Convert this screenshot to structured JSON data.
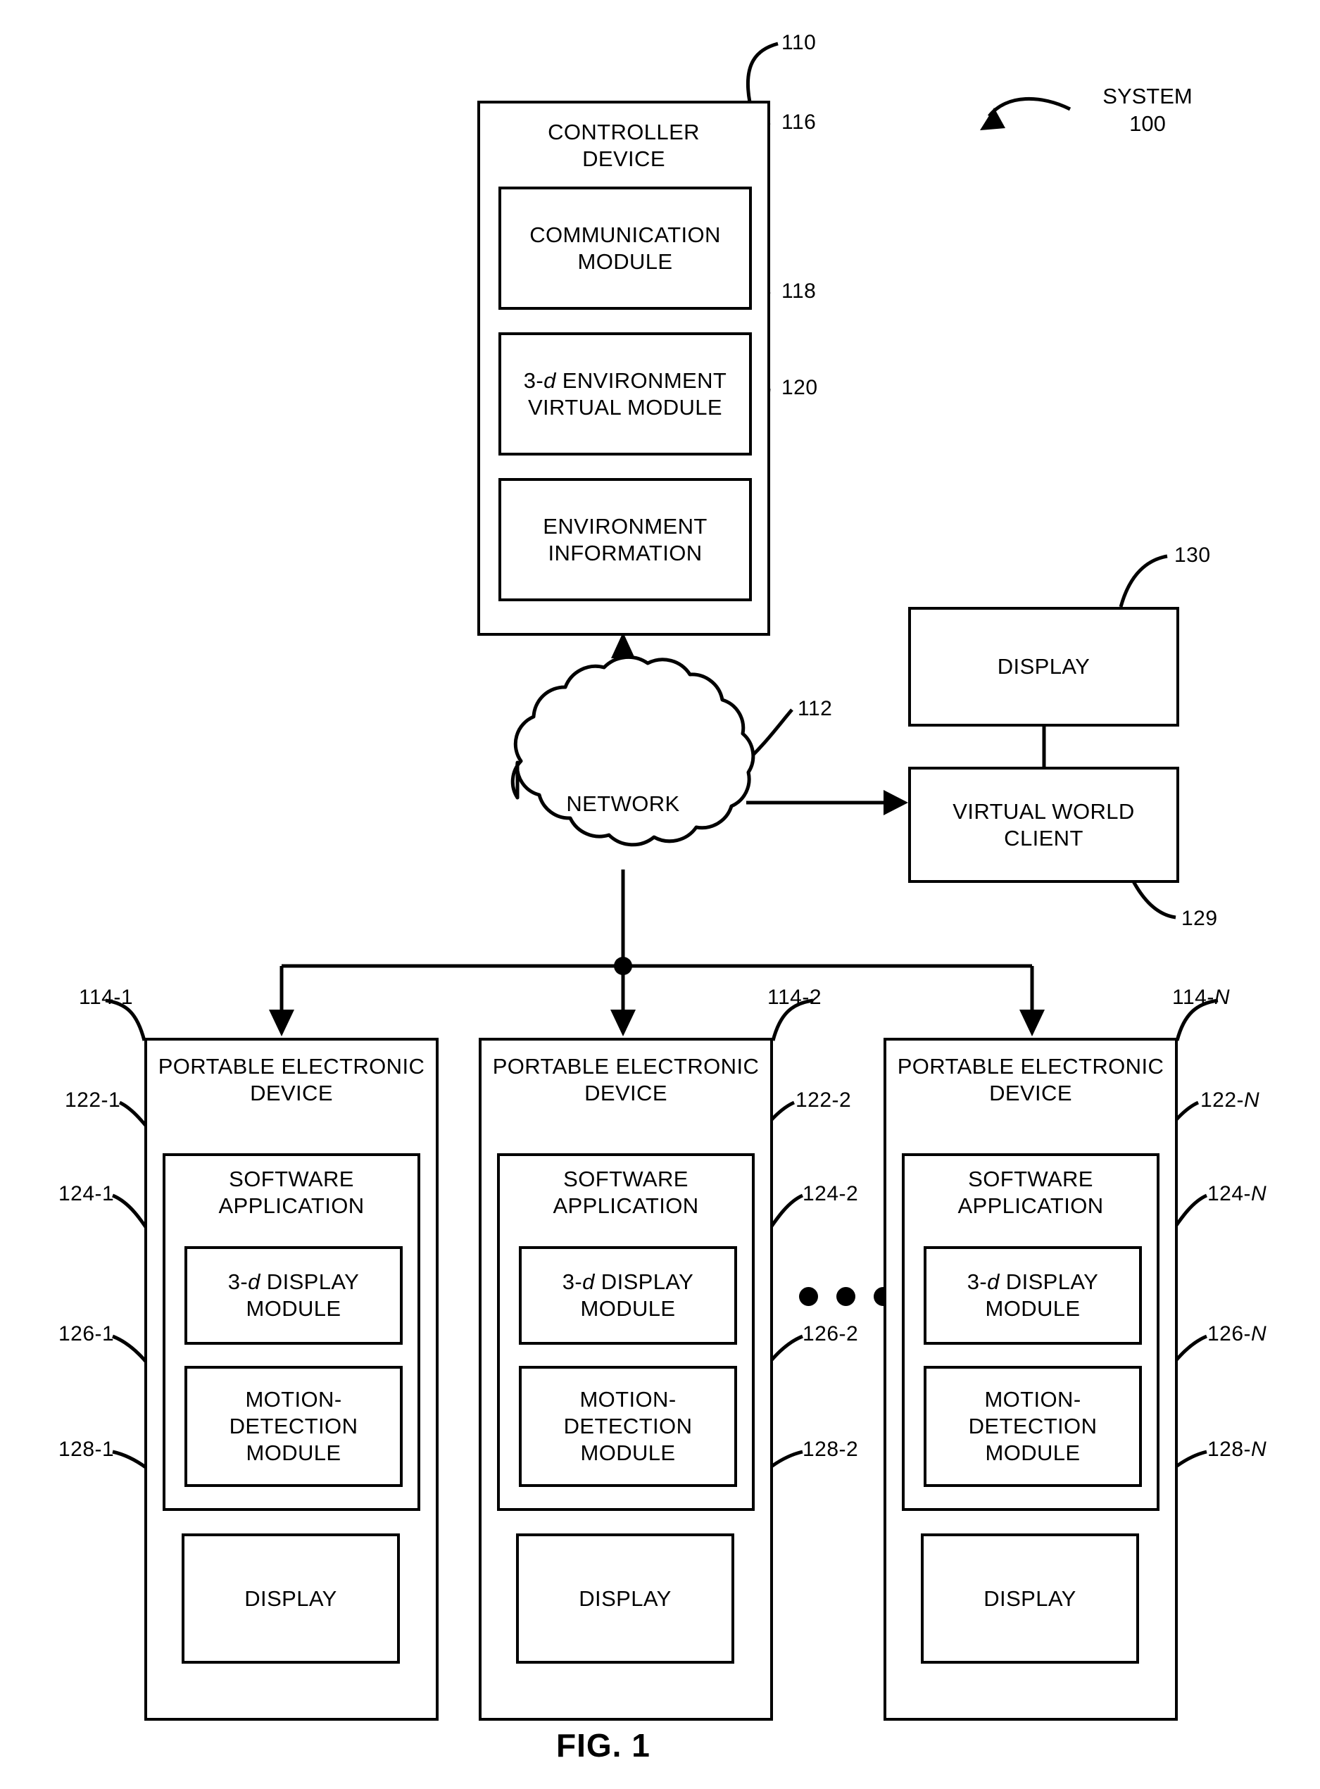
{
  "figure": {
    "caption": "FIG. 1",
    "system_label_line1": "SYSTEM",
    "system_label_line2": "100"
  },
  "controller": {
    "ref": "110",
    "title_line1": "CONTROLLER",
    "title_line2": "DEVICE",
    "modules": [
      {
        "ref": "116",
        "line1": "COMMUNICATION",
        "line2": "MODULE"
      },
      {
        "ref": "118",
        "line1": "3-d ENVIRONMENT",
        "line2": "VIRTUAL MODULE"
      },
      {
        "ref": "120",
        "line1": "ENVIRONMENT",
        "line2": "INFORMATION"
      }
    ]
  },
  "network": {
    "ref": "112",
    "label": "NETWORK"
  },
  "client_side": {
    "display": {
      "ref": "130",
      "label": "DISPLAY"
    },
    "virtual_world_client": {
      "ref": "129",
      "line1": "VIRTUAL WORLD",
      "line2": "CLIENT"
    }
  },
  "devices": [
    {
      "ref": "114-1",
      "title_line1": "PORTABLE ELECTRONIC",
      "title_line2": "DEVICE",
      "software_application": {
        "ref": "122-1",
        "line1": "SOFTWARE",
        "line2": "APPLICATION",
        "modules": [
          {
            "ref": "124-1",
            "line1": "3-d DISPLAY",
            "line2": "MODULE"
          },
          {
            "ref": "126-1",
            "line1": "MOTION-",
            "line2": "DETECTION",
            "line3": "MODULE"
          }
        ]
      },
      "display": {
        "ref": "128-1",
        "label": "DISPLAY"
      }
    },
    {
      "ref": "114-2",
      "title_line1": "PORTABLE ELECTRONIC",
      "title_line2": "DEVICE",
      "software_application": {
        "ref": "122-2",
        "line1": "SOFTWARE",
        "line2": "APPLICATION",
        "modules": [
          {
            "ref": "124-2",
            "line1": "3-d DISPLAY",
            "line2": "MODULE"
          },
          {
            "ref": "126-2",
            "line1": "MOTION-",
            "line2": "DETECTION",
            "line3": "MODULE"
          }
        ]
      },
      "display": {
        "ref": "128-2",
        "label": "DISPLAY"
      }
    },
    {
      "ref": "114-N",
      "title_line1": "PORTABLE ELECTRONIC",
      "title_line2": "DEVICE",
      "software_application": {
        "ref": "122-N",
        "line1": "SOFTWARE",
        "line2": "APPLICATION",
        "modules": [
          {
            "ref": "124-N",
            "line1": "3-d DISPLAY",
            "line2": "MODULE"
          },
          {
            "ref": "126-N",
            "line1": "MOTION-",
            "line2": "DETECTION",
            "line3": "MODULE"
          }
        ]
      },
      "display": {
        "ref": "128-N",
        "label": "DISPLAY"
      }
    }
  ],
  "ellipsis": "• • •",
  "colors": {
    "ink": "#000000",
    "paper": "#ffffff"
  }
}
